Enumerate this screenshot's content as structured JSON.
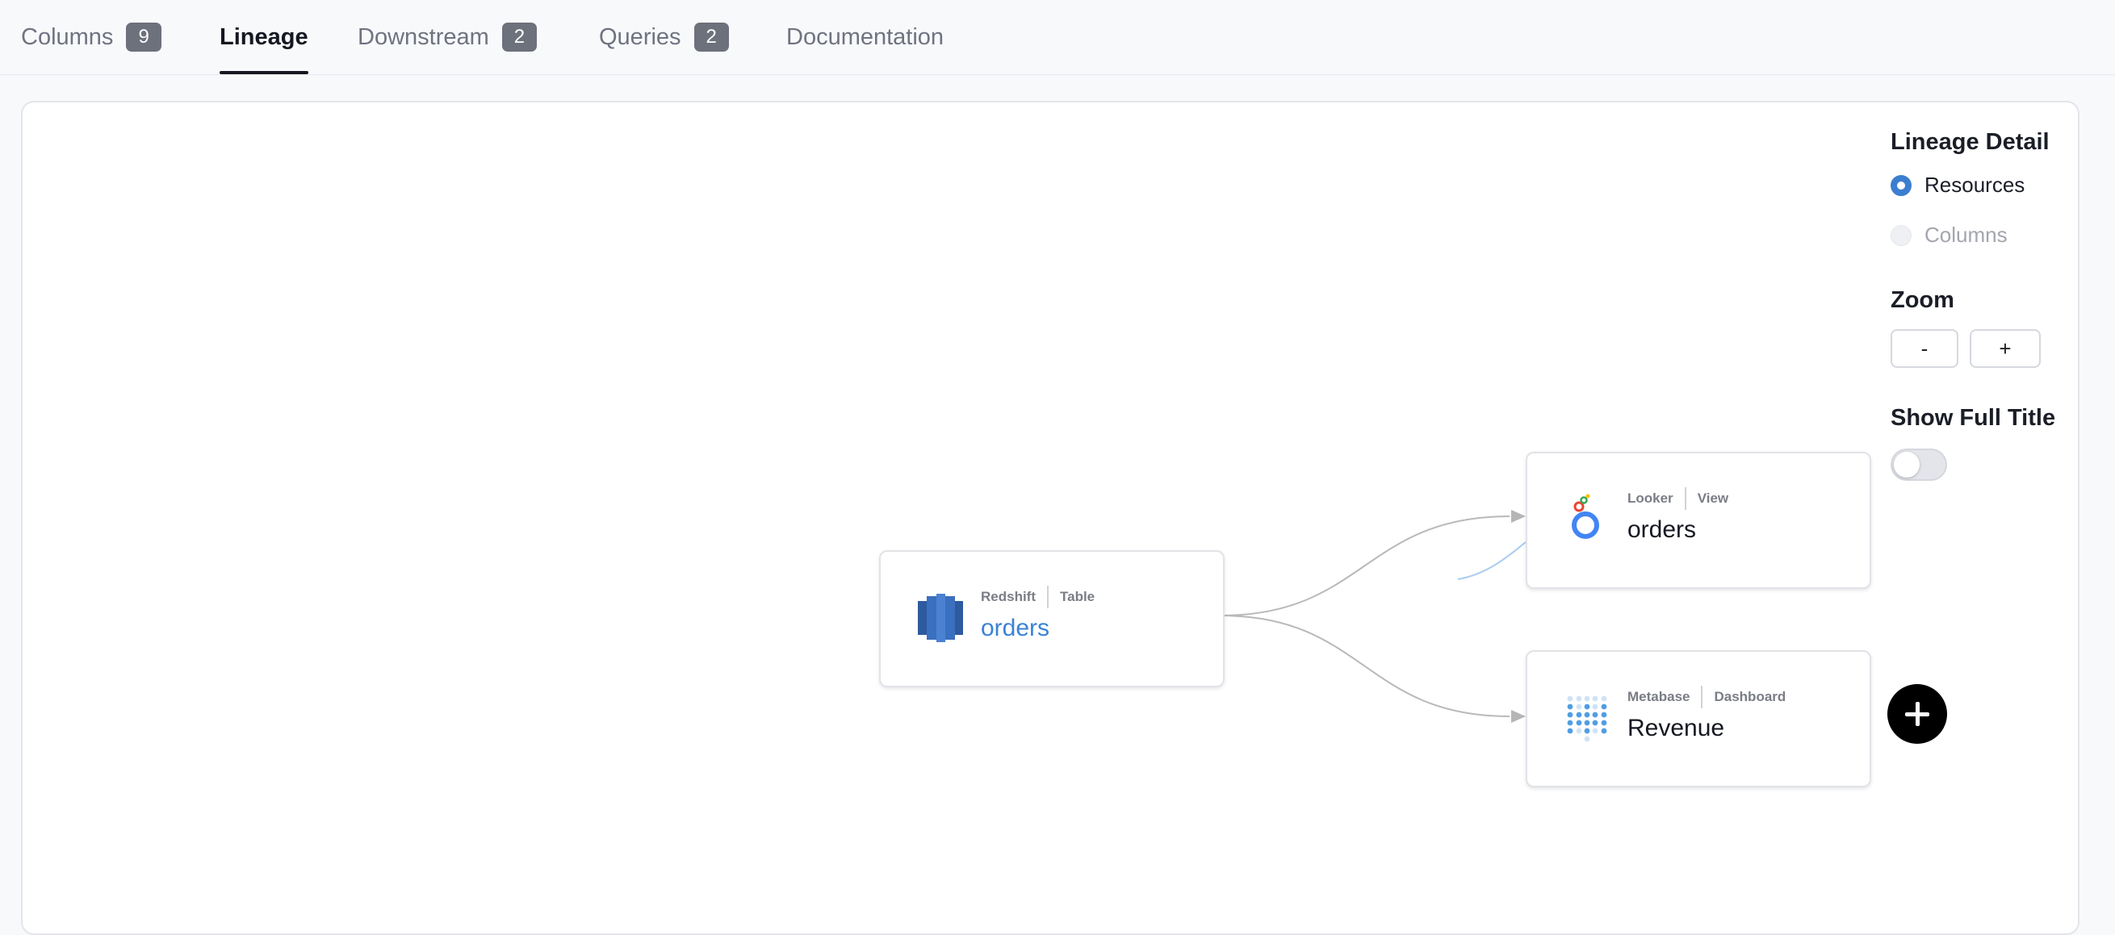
{
  "tabs": [
    {
      "label": "Columns",
      "count": "9",
      "active": false
    },
    {
      "label": "Lineage",
      "active": true
    },
    {
      "label": "Downstream",
      "count": "2",
      "active": false
    },
    {
      "label": "Queries",
      "count": "2",
      "active": false
    },
    {
      "label": "Documentation",
      "active": false
    }
  ],
  "nodes": {
    "source": {
      "platform": "Redshift",
      "type": "Table",
      "title": "orders",
      "icon": "redshift-icon"
    },
    "looker": {
      "platform": "Looker",
      "type": "View",
      "title": "orders",
      "icon": "looker-icon"
    },
    "metabase": {
      "platform": "Metabase",
      "type": "Dashboard",
      "title": "Revenue",
      "icon": "metabase-icon"
    }
  },
  "panel": {
    "lineage_detail_title": "Lineage Detail",
    "options": {
      "resources": "Resources",
      "columns": "Columns"
    },
    "selected": "Resources",
    "zoom_title": "Zoom",
    "zoom_out_label": "-",
    "zoom_in_label": "+",
    "show_full_title_label": "Show Full Title",
    "show_full_title_on": false
  },
  "colors": {
    "accent": "#3b82d6",
    "edge": "#b9b9b9",
    "tab_badge": "#6d717c"
  }
}
